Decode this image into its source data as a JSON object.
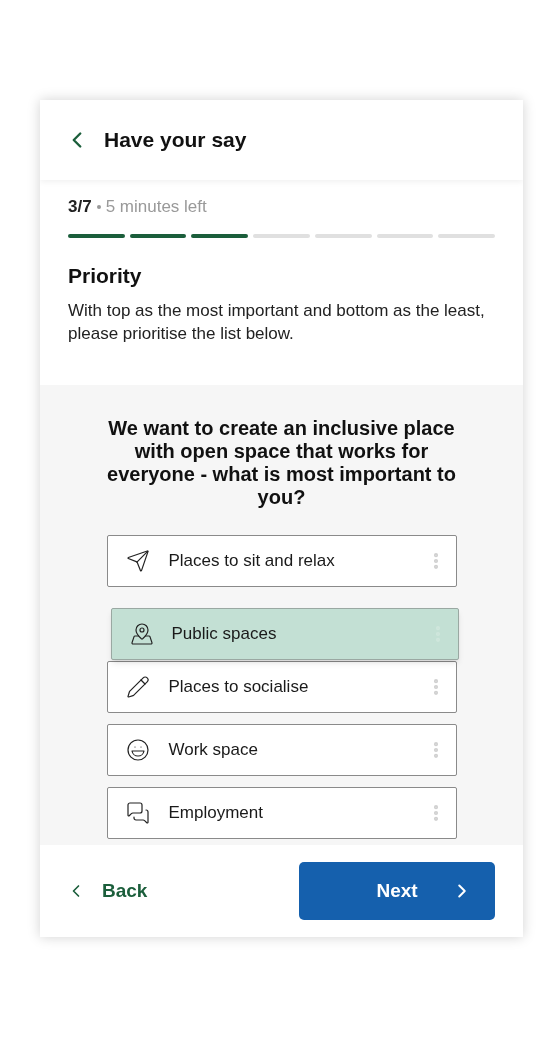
{
  "header": {
    "title": "Have your say"
  },
  "progress": {
    "step": "3/7",
    "time_left": "5 minutes left",
    "segments": [
      {
        "complete": true
      },
      {
        "complete": true
      },
      {
        "complete": true
      },
      {
        "complete": false
      },
      {
        "complete": false
      },
      {
        "complete": false
      },
      {
        "complete": false
      }
    ]
  },
  "section": {
    "title": "Priority",
    "description": "With top as the most important and bottom as the least, please prioritise the list below."
  },
  "question": "We want to create an inclusive place with open space that works for everyone - what is most important to you?",
  "items": [
    {
      "label": "Places to sit and relax",
      "dragging": false
    },
    {
      "label": "Public spaces",
      "dragging": true
    },
    {
      "label": "Places to socialise",
      "dragging": false
    },
    {
      "label": "Work space",
      "dragging": false
    },
    {
      "label": "Employment",
      "dragging": false
    }
  ],
  "footer": {
    "back": "Back",
    "next": "Next"
  }
}
